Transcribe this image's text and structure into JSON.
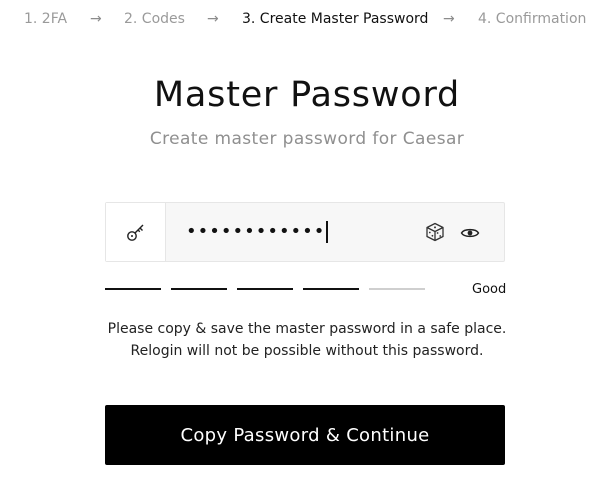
{
  "steps": [
    {
      "label": "1. 2FA",
      "active": false
    },
    {
      "label": "2. Codes",
      "active": false
    },
    {
      "label": "3. Create Master Password",
      "active": true
    },
    {
      "label": "4. Confirmation",
      "active": false
    }
  ],
  "step_separator": "→",
  "title": "Master Password",
  "subtitle": "Create master password for Caesar",
  "password_field": {
    "masked_value": "••••••••••••",
    "key_icon": "key-icon",
    "generate_icon": "dice-icon",
    "toggle_icon": "eye-icon"
  },
  "strength": {
    "segments_total": 5,
    "segments_filled": 4,
    "label": "Good",
    "filled_color": "#111111",
    "empty_color": "#cfcfcf"
  },
  "notice": {
    "line1": "Please copy & save the master password in a safe place.",
    "line2": "Relogin will not be possible without this password."
  },
  "cta_label": "Copy Password & Continue",
  "colors": {
    "primary": "#000000",
    "muted_text": "#9a9a9a",
    "border": "#e6e6e6",
    "field_bg": "#f7f7f7"
  }
}
